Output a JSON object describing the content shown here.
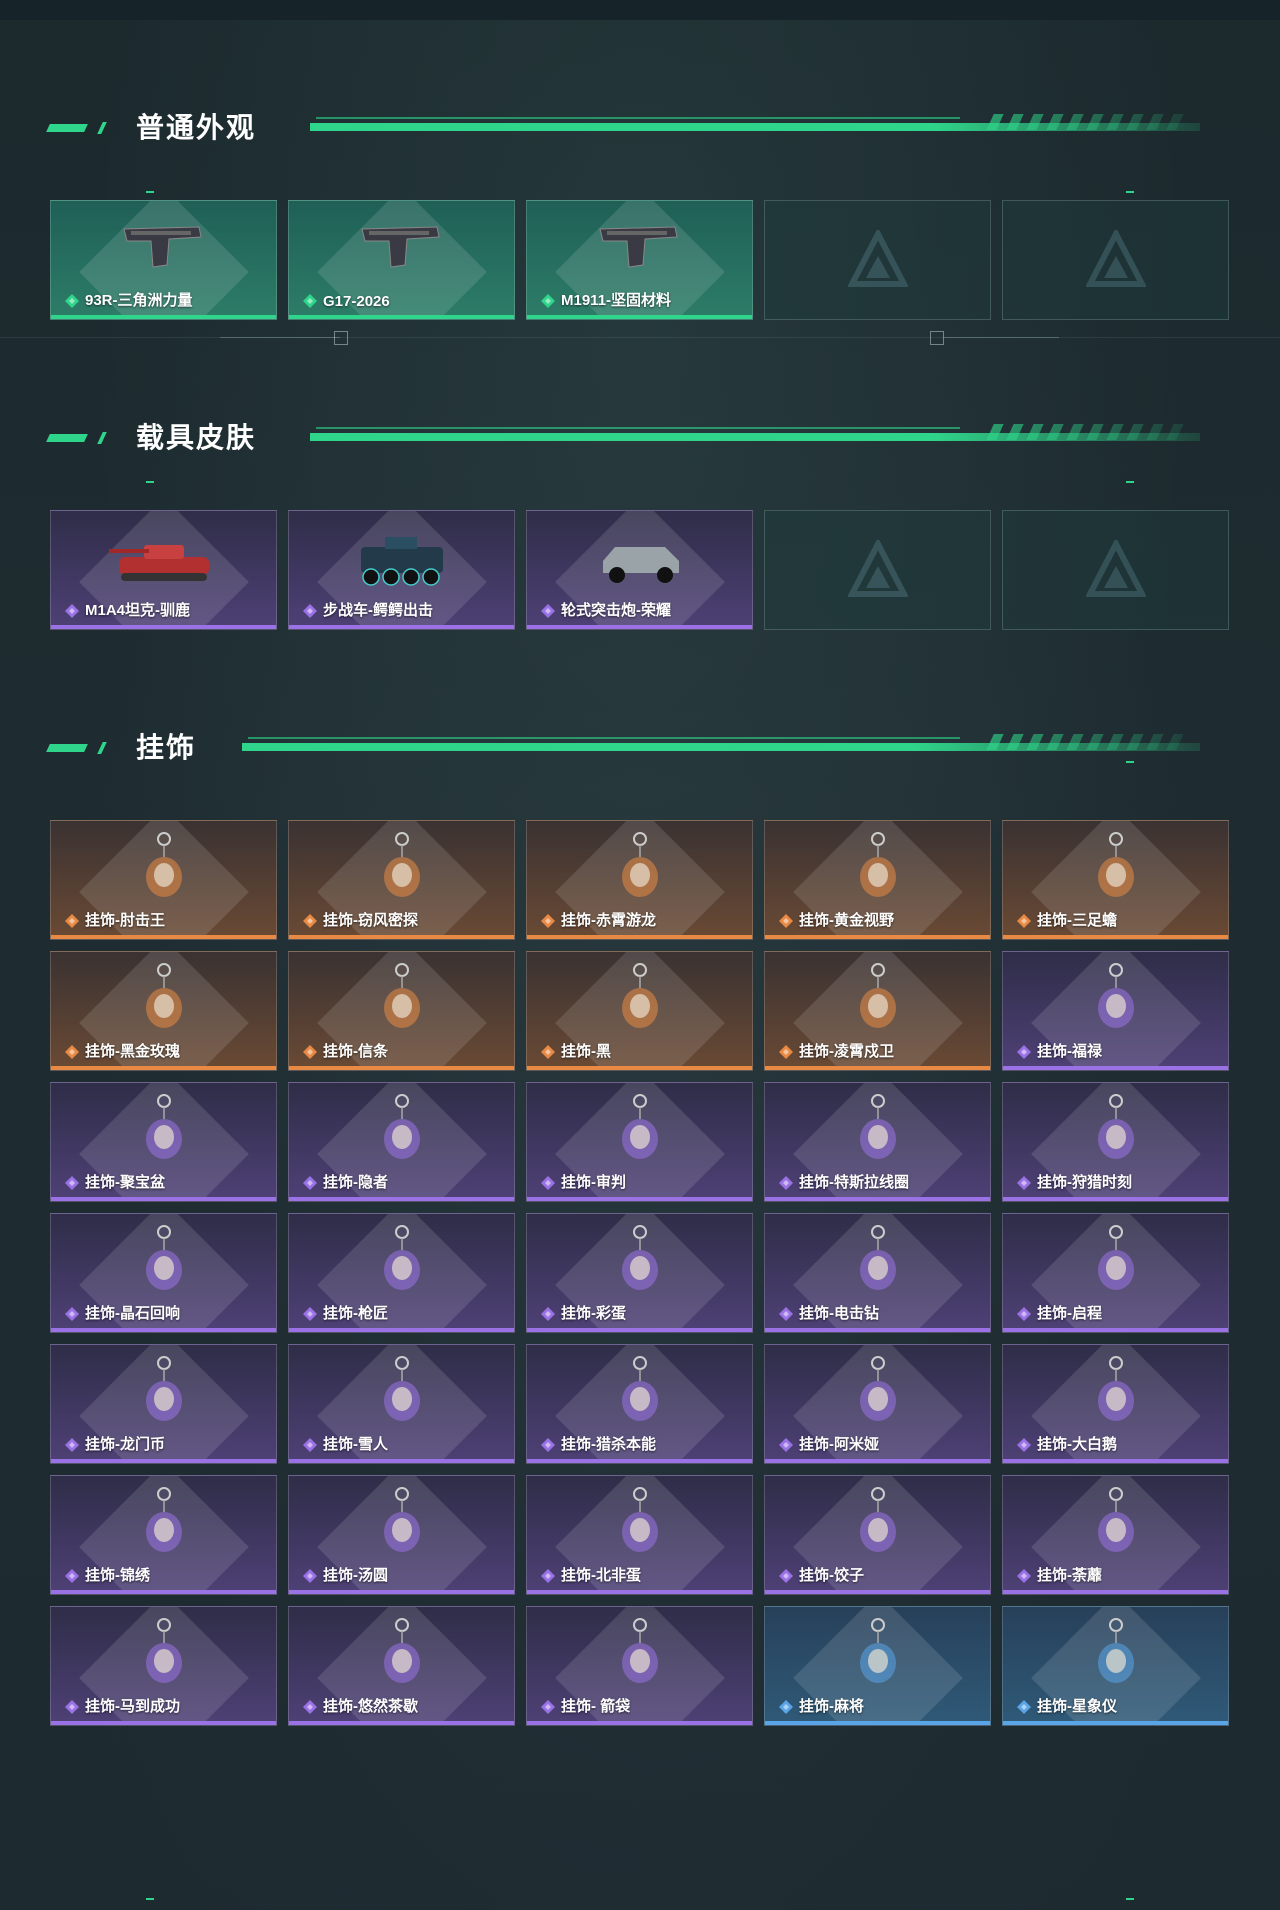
{
  "colors": {
    "accent": "#2fd58a",
    "rare_purple": "#9a72e6",
    "legendary_orange": "#e88a44",
    "epic_blue": "#5aa4e8"
  },
  "sections": [
    {
      "title": "普通外观",
      "items": [
        {
          "name": "93R-三角洲力量",
          "rarity": "green",
          "icon": "pistol-icon"
        },
        {
          "name": "G17-2026",
          "rarity": "green",
          "icon": "pistol-icon"
        },
        {
          "name": "M1911-坚固材料",
          "rarity": "green",
          "icon": "pistol-icon"
        },
        {
          "name": "",
          "rarity": "empty",
          "icon": "delta-logo-icon"
        },
        {
          "name": "",
          "rarity": "empty",
          "icon": "delta-logo-icon"
        }
      ]
    },
    {
      "title": "载具皮肤",
      "items": [
        {
          "name": "M1A4坦克-驯鹿",
          "rarity": "purple",
          "icon": "tank-icon"
        },
        {
          "name": "步战车-鳄鳄出击",
          "rarity": "purple",
          "icon": "ifv-icon"
        },
        {
          "name": "轮式突击炮-荣耀",
          "rarity": "purple",
          "icon": "armored-car-icon"
        },
        {
          "name": "",
          "rarity": "empty",
          "icon": "delta-logo-icon"
        },
        {
          "name": "",
          "rarity": "empty",
          "icon": "delta-logo-icon"
        }
      ]
    },
    {
      "title": "挂饰",
      "items": [
        {
          "name": "挂饰-肘击王",
          "rarity": "orange",
          "icon": "charm-icon"
        },
        {
          "name": "挂饰-窃风密探",
          "rarity": "orange",
          "icon": "charm-icon"
        },
        {
          "name": "挂饰-赤霄游龙",
          "rarity": "orange",
          "icon": "charm-icon"
        },
        {
          "name": "挂饰-黄金视野",
          "rarity": "orange",
          "icon": "charm-icon"
        },
        {
          "name": "挂饰-三足蟾",
          "rarity": "orange",
          "icon": "charm-icon"
        },
        {
          "name": "挂饰-黑金玫瑰",
          "rarity": "orange",
          "icon": "charm-icon"
        },
        {
          "name": "挂饰-信条",
          "rarity": "orange",
          "icon": "charm-icon"
        },
        {
          "name": "挂饰-黑",
          "rarity": "orange",
          "icon": "charm-icon"
        },
        {
          "name": "挂饰-凌霄戍卫",
          "rarity": "orange",
          "icon": "charm-icon"
        },
        {
          "name": "挂饰-福禄",
          "rarity": "purple",
          "icon": "charm-icon"
        },
        {
          "name": "挂饰-聚宝盆",
          "rarity": "purple",
          "icon": "charm-icon"
        },
        {
          "name": "挂饰-隐者",
          "rarity": "purple",
          "icon": "charm-icon"
        },
        {
          "name": "挂饰-审判",
          "rarity": "purple",
          "icon": "charm-icon"
        },
        {
          "name": "挂饰-特斯拉线圈",
          "rarity": "purple",
          "icon": "charm-icon"
        },
        {
          "name": "挂饰-狩猎时刻",
          "rarity": "purple",
          "icon": "charm-icon"
        },
        {
          "name": "挂饰-晶石回响",
          "rarity": "purple",
          "icon": "charm-icon"
        },
        {
          "name": "挂饰-枪匠",
          "rarity": "purple",
          "icon": "charm-icon"
        },
        {
          "name": "挂饰-彩蛋",
          "rarity": "purple",
          "icon": "charm-icon"
        },
        {
          "name": "挂饰-电击钻",
          "rarity": "purple",
          "icon": "charm-icon"
        },
        {
          "name": "挂饰-启程",
          "rarity": "purple",
          "icon": "charm-icon"
        },
        {
          "name": "挂饰-龙门币",
          "rarity": "purple",
          "icon": "charm-icon"
        },
        {
          "name": "挂饰-雪人",
          "rarity": "purple",
          "icon": "charm-icon"
        },
        {
          "name": "挂饰-猎杀本能",
          "rarity": "purple",
          "icon": "charm-icon"
        },
        {
          "name": "挂饰-阿米娅",
          "rarity": "purple",
          "icon": "charm-icon"
        },
        {
          "name": "挂饰-大白鹅",
          "rarity": "purple",
          "icon": "charm-icon"
        },
        {
          "name": "挂饰-锦绣",
          "rarity": "purple",
          "icon": "charm-icon"
        },
        {
          "name": "挂饰-汤圆",
          "rarity": "purple",
          "icon": "charm-icon"
        },
        {
          "name": "挂饰-北非蛋",
          "rarity": "purple",
          "icon": "charm-icon"
        },
        {
          "name": "挂饰-饺子",
          "rarity": "purple",
          "icon": "charm-icon"
        },
        {
          "name": "挂饰-荼蘼",
          "rarity": "purple",
          "icon": "charm-icon"
        },
        {
          "name": "挂饰-马到成功",
          "rarity": "purple",
          "icon": "charm-icon"
        },
        {
          "name": "挂饰-悠然茶歇",
          "rarity": "purple",
          "icon": "charm-icon"
        },
        {
          "name": "挂饰- 箭袋",
          "rarity": "purple",
          "icon": "charm-icon"
        },
        {
          "name": "挂饰-麻将",
          "rarity": "blue",
          "icon": "charm-icon"
        },
        {
          "name": "挂饰-星象仪",
          "rarity": "blue",
          "icon": "charm-icon"
        }
      ]
    }
  ]
}
